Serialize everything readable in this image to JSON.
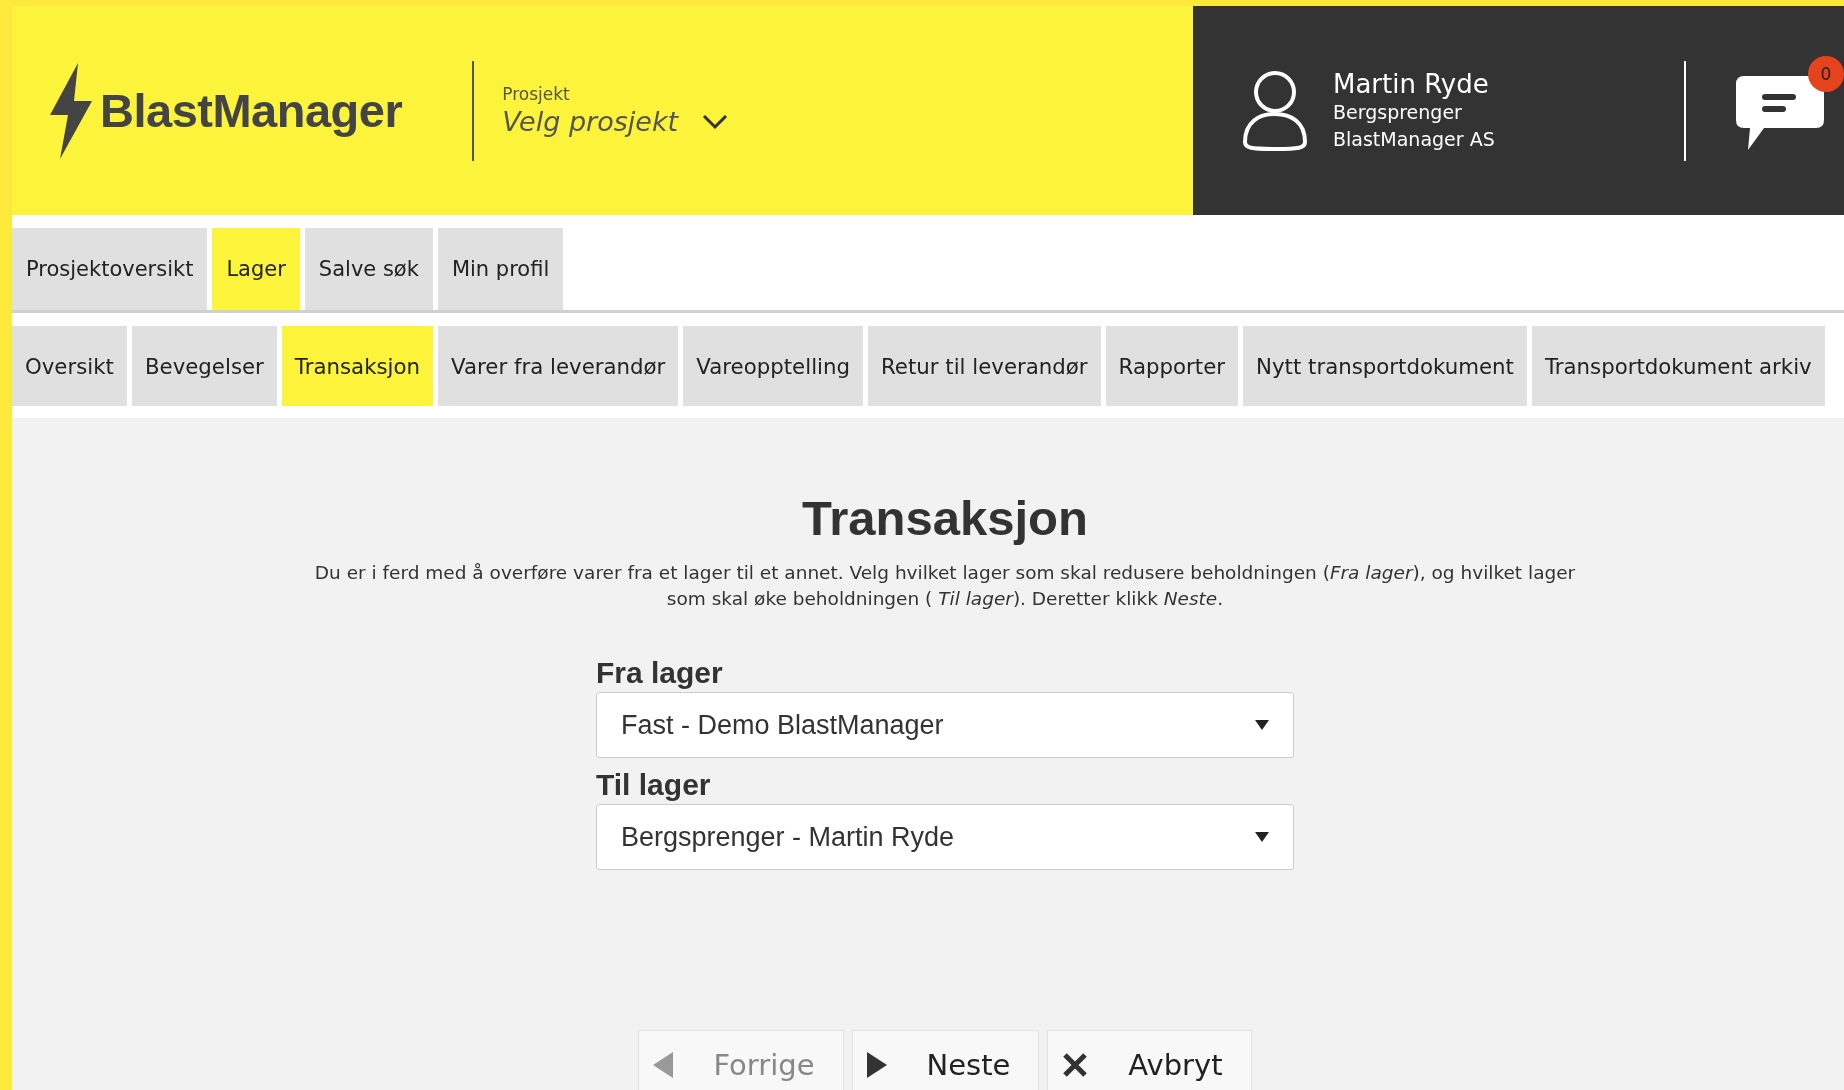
{
  "app": {
    "logo": "BlastManager"
  },
  "project": {
    "label": "Prosjekt",
    "placeholder": "Velg prosjekt"
  },
  "user": {
    "name": "Martin Ryde",
    "role": "Bergsprenger",
    "company": "BlastManager AS"
  },
  "messages": {
    "count": "0"
  },
  "main_tabs": [
    {
      "label": "Prosjektoversikt",
      "selected": false
    },
    {
      "label": "Lager",
      "selected": true
    },
    {
      "label": "Salve søk",
      "selected": false
    },
    {
      "label": "Min profil",
      "selected": false
    }
  ],
  "sub_tabs": [
    {
      "label": "Oversikt",
      "selected": false
    },
    {
      "label": "Bevegelser",
      "selected": false
    },
    {
      "label": "Transaksjon",
      "selected": true
    },
    {
      "label": "Varer fra leverandør",
      "selected": false
    },
    {
      "label": "Vareopptelling",
      "selected": false
    },
    {
      "label": "Retur til leverandør",
      "selected": false
    },
    {
      "label": "Rapporter",
      "selected": false
    },
    {
      "label": "Nytt transportdokument",
      "selected": false
    },
    {
      "label": "Transportdokument arkiv",
      "selected": false
    }
  ],
  "page": {
    "title": "Transaksjon",
    "description": "Du er i ferd med å overføre varer fra et lager til et annet. Velg hvilket lager som skal redusere beholdningen (*Fra lager*), og hvilket lager som skal øke beholdningen ( *Til lager*). Deretter klikk *Neste*."
  },
  "fields": [
    {
      "label": "Fra lager",
      "value": "Fast - Demo BlastManager"
    },
    {
      "label": "Til lager",
      "value": "Bergsprenger - Martin Ryde"
    }
  ],
  "buttons": [
    {
      "kind": "previous",
      "label": "Forrige",
      "disabled": true
    },
    {
      "kind": "next",
      "label": "Neste",
      "disabled": false
    },
    {
      "kind": "cancel",
      "label": "Avbryt",
      "disabled": false
    }
  ]
}
